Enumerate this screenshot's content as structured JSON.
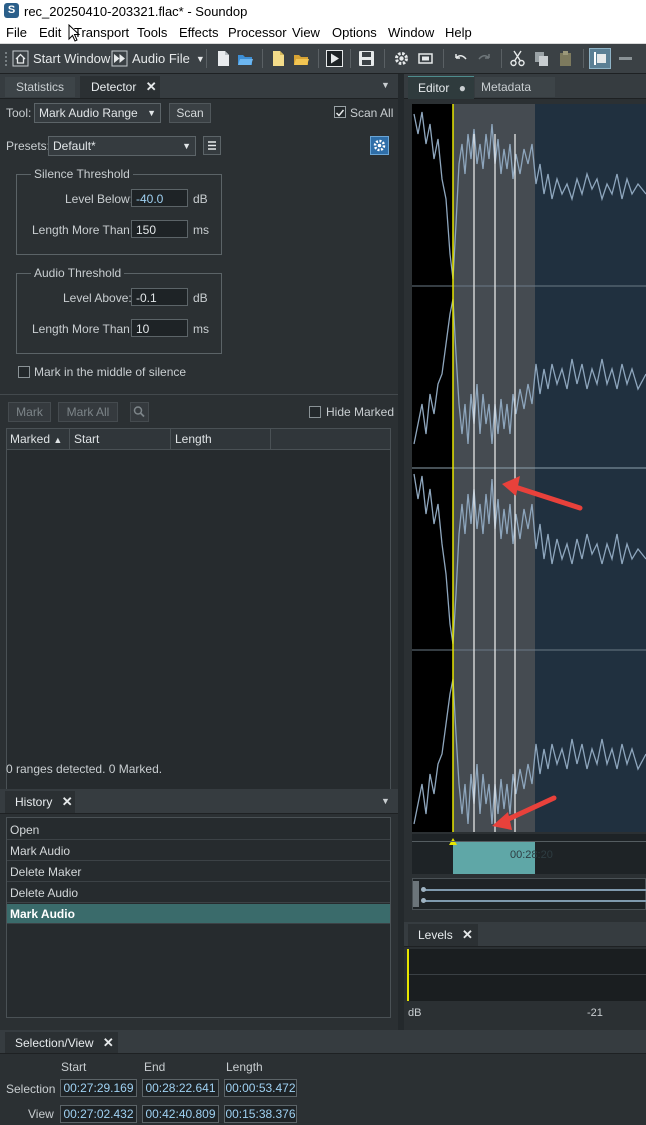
{
  "window": {
    "app_icon": "S",
    "title": "rec_20250410-203321.flac* - Soundop"
  },
  "menu": [
    "File",
    "Edit",
    "Transport",
    "Tools",
    "Effects",
    "Processor",
    "View",
    "Options",
    "Window",
    "Help"
  ],
  "toolbar": {
    "start_window": "Start Window",
    "audio_file": "Audio File"
  },
  "detector_panel": {
    "tabs": {
      "statistics": "Statistics",
      "detector": "Detector"
    },
    "tool_label": "Tool:",
    "tool_value": "Mark Audio Range",
    "scan_button": "Scan",
    "scan_all_label": "Scan All",
    "scan_all_checked": true,
    "presets_label": "Presets:",
    "presets_value": "Default*",
    "silence": {
      "title": "Silence Threshold",
      "level_label": "Level Below:",
      "level_value": "-40.0",
      "level_unit": "dB",
      "length_label": "Length More Than:",
      "length_value": "150",
      "length_unit": "ms"
    },
    "audio": {
      "title": "Audio Threshold",
      "level_label": "Level Above:",
      "level_value": "-0.1",
      "level_unit": "dB",
      "length_label": "Length More Than:",
      "length_value": "10",
      "length_unit": "ms"
    },
    "mark_middle_label": "Mark in the middle of silence",
    "mark_button": "Mark",
    "mark_all_button": "Mark All",
    "hide_marked_label": "Hide Marked",
    "columns": [
      "Marked",
      "Start",
      "Length"
    ],
    "status": "0 ranges detected. 0 Marked."
  },
  "history_panel": {
    "tab": "History",
    "items": [
      "Open",
      "Mark Audio",
      "Delete Maker",
      "Delete Audio",
      "Mark Audio"
    ],
    "selected_index": 4
  },
  "selection_view": {
    "tab": "Selection/View",
    "headers": {
      "start": "Start",
      "end": "End",
      "length": "Length"
    },
    "selection_label": "Selection",
    "selection": {
      "start": "00:27:29.169",
      "end": "00:28:22.641",
      "length": "00:00:53.472"
    },
    "view_label": "View",
    "view": {
      "start": "00:27:02.432",
      "end": "00:42:40.809",
      "length": "00:15:38.376"
    }
  },
  "editor": {
    "tabs": {
      "editor": "Editor",
      "metadata": "Metadata"
    },
    "timeline_label": "00:28:20"
  },
  "levels_panel": {
    "tab": "Levels",
    "scale_db": "dB",
    "scale_mark": "-21"
  },
  "colors": {
    "accent": "#3a6b6b",
    "selection": "#7b8a95",
    "arrow": "#e8413b",
    "cursor": "#e6e600"
  }
}
